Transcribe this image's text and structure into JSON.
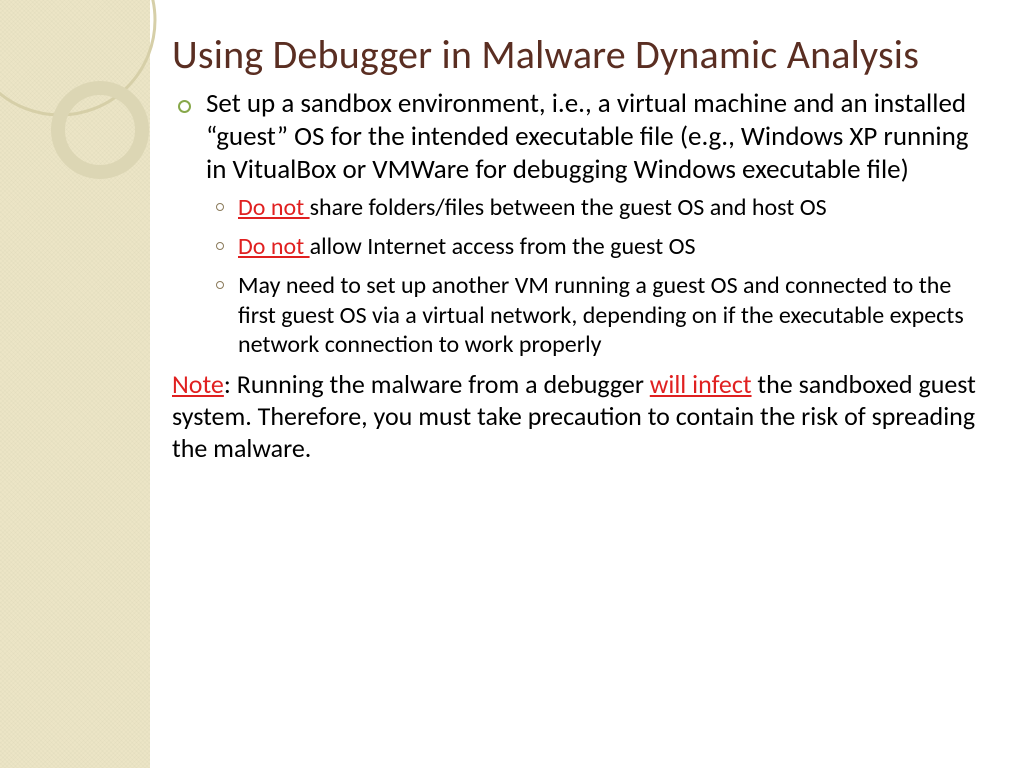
{
  "title": "Using Debugger in Malware Dynamic Analysis",
  "bullets": [
    {
      "text": "Set up a sandbox environment, i.e., a virtual machine and an installed “guest” OS for the intended executable file (e.g., Windows XP running in VitualBox or VMWare for debugging Windows executable file)",
      "sub": [
        {
          "warn": "Do not ",
          "rest": "share folders/files between the guest OS and host OS"
        },
        {
          "warn": "Do not ",
          "rest": "allow Internet access from the guest OS"
        },
        {
          "rest": "May need to set up another VM running a guest OS and connected to the first guest OS via a virtual network, depending on if the executable expects network connection to work properly"
        }
      ]
    }
  ],
  "note": {
    "label": "Note",
    "part1": ":  Running the malware from a debugger ",
    "warn2": "will infect",
    "part2": " the sandboxed guest system.  Therefore, you must take precaution to contain the risk of spreading the malware."
  }
}
